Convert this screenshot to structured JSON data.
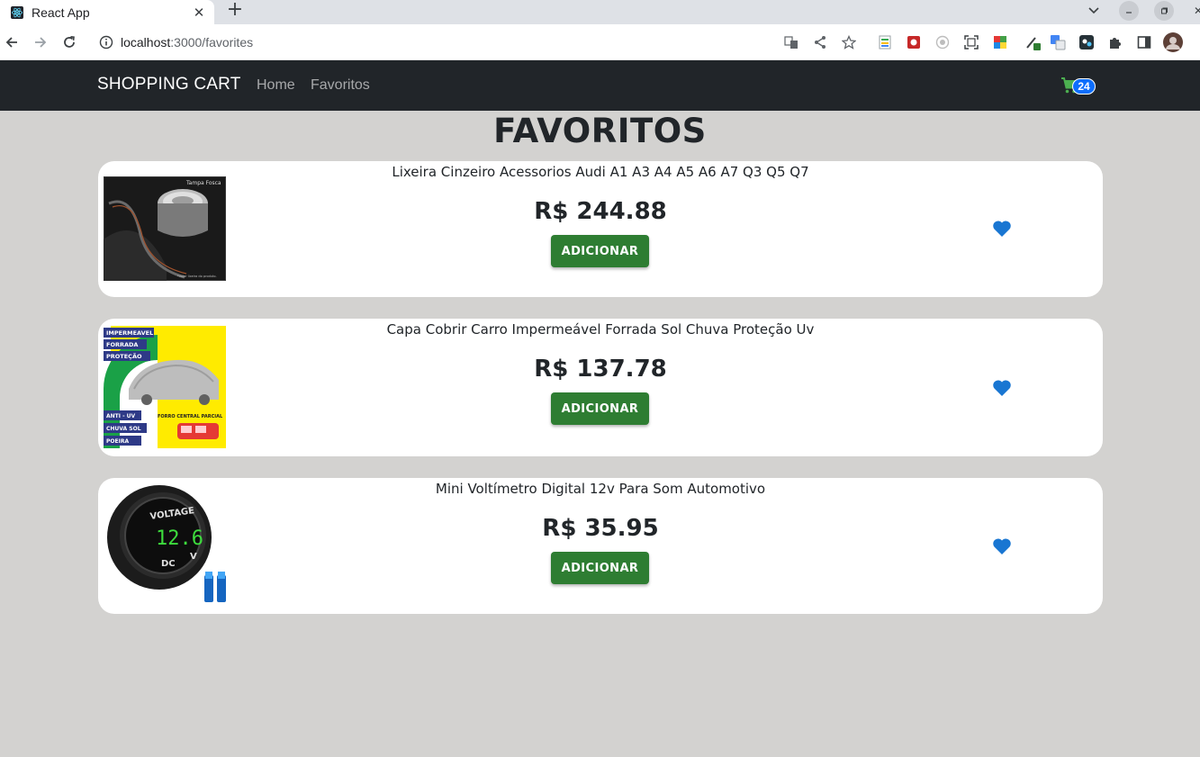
{
  "browser": {
    "tab_title": "React App",
    "url_host": "localhost",
    "url_path": ":3000/favorites"
  },
  "navbar": {
    "brand": "SHOPPING CART",
    "links": [
      "Home",
      "Favoritos"
    ],
    "cart_count": "24"
  },
  "page": {
    "title": "FAVORITOS"
  },
  "products": [
    {
      "title": "Lixeira Cinzeiro Acessorios Audi A1 A3 A4 A5 A6 A7 Q3 Q5 Q7",
      "price": "R$ 244.88",
      "button": "ADICIONAR",
      "image_label": "Tampa Fosca",
      "image_note": "*Valor lixeira do produto."
    },
    {
      "title": "Capa Cobrir Carro Impermeável Forrada Sol Chuva Proteção Uv",
      "price": "R$ 137.78",
      "button": "ADICIONAR",
      "image_tags_top": [
        "IMPERMEAVEL",
        "FORRADA",
        "PROTEÇÃO"
      ],
      "image_tags_bottom": [
        "ANTI - UV",
        "CHUVA SOL",
        "POEIRA"
      ],
      "image_side_label": "FORRO CENTRAL PARCIAL"
    },
    {
      "title": "Mini Voltímetro Digital 12v Para Som Automotivo",
      "price": "R$ 35.95",
      "button": "ADICIONAR",
      "image_label": "VOLTAGE",
      "image_reading": "12.6",
      "image_unit_dc": "DC",
      "image_unit_v": "V"
    }
  ],
  "colors": {
    "navbar_bg": "#212529",
    "page_bg": "#d3d2d0",
    "button_bg": "#2e7d32",
    "heart": "#1976d2",
    "badge": "#0d6efd"
  }
}
